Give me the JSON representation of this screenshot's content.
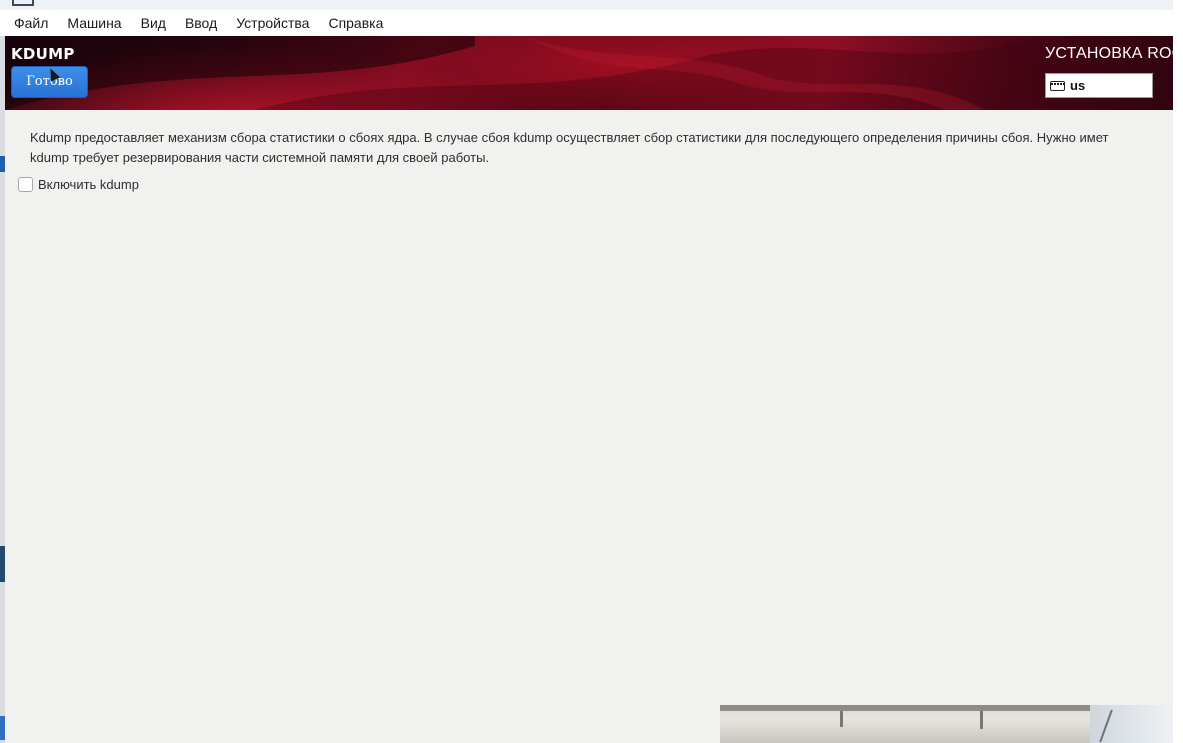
{
  "menubar": {
    "items": [
      "Файл",
      "Машина",
      "Вид",
      "Ввод",
      "Устройства",
      "Справка"
    ]
  },
  "header": {
    "spoke_title": "KDUMP",
    "done_label": "Готово",
    "product_title": "УСТАНОВКА ROC",
    "keyboard_layout": "us",
    "keyboard_icon": "keyboard-icon"
  },
  "content": {
    "description_line1": "Kdump предоставляет механизм сбора статистики о сбоях ядра. В случае сбоя kdump осуществляет сбор статистики для последующего определения причины сбоя. Нужно имет",
    "description_line2": "kdump требует резервирования части системной памяти для своей работы.",
    "enable_label": "Включить kdump",
    "enable_checked": false
  },
  "colors": {
    "header_dark": "#2a0510",
    "header_red": "#8c0e24",
    "done_button": "#2873d6",
    "background": "#f1f1f0"
  }
}
